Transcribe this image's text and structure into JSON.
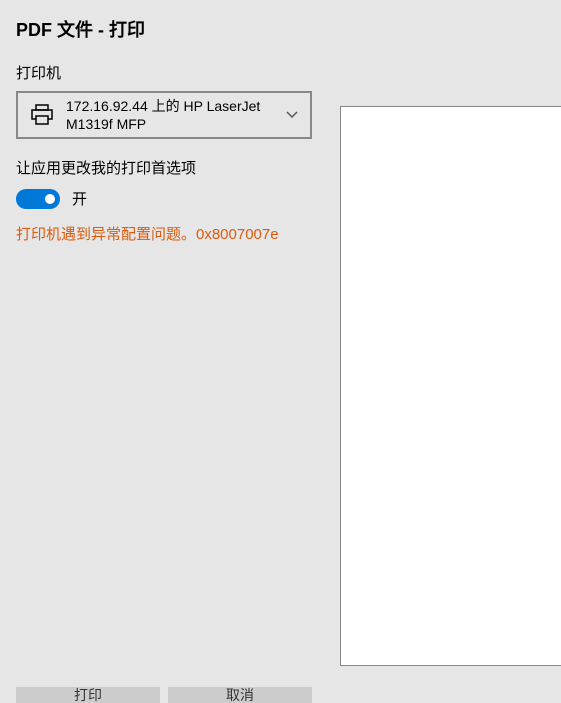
{
  "dialog": {
    "title": "PDF 文件 - 打印"
  },
  "printer": {
    "section_label": "打印机",
    "selected_name": "172.16.92.44 上的 HP LaserJet M1319f MFP"
  },
  "preferences": {
    "label": "让应用更改我的打印首选项",
    "toggle_state": "开"
  },
  "error": {
    "message": "打印机遇到异常配置问题。0x8007007e"
  },
  "buttons": {
    "print": "打印",
    "cancel": "取消"
  }
}
